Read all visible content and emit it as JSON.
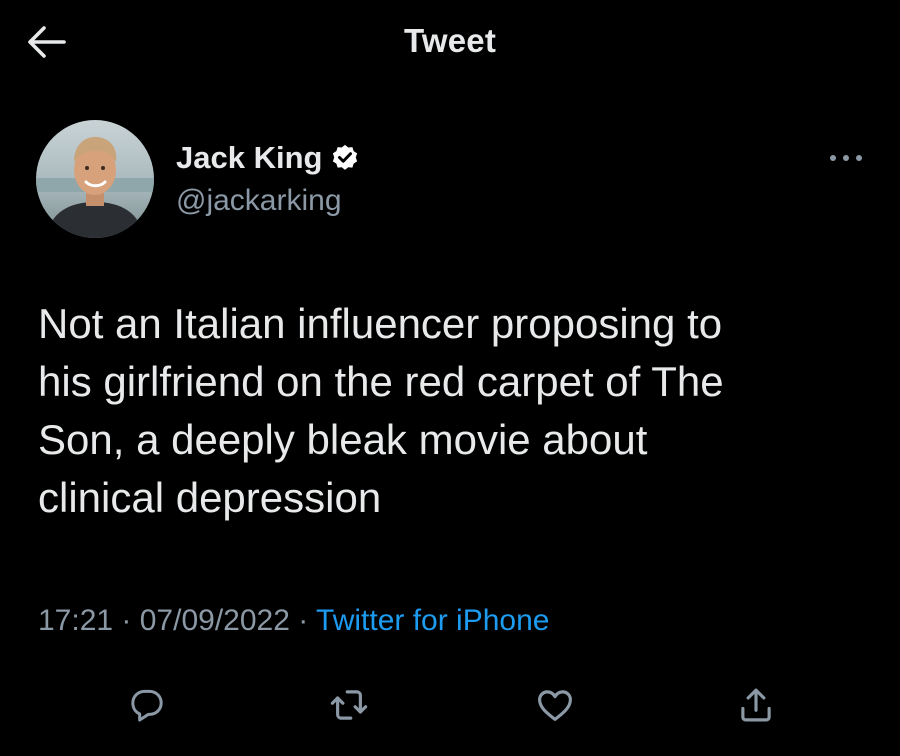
{
  "header": {
    "title": "Tweet",
    "back_icon": "arrow-left-icon"
  },
  "author": {
    "display_name": "Jack King",
    "handle": "@jackarking",
    "verified": true,
    "verified_color": "#ffffff"
  },
  "tweet": {
    "text": "Not an Italian influencer proposing to\nhis girlfriend on the red carpet of The\nSon, a deeply bleak movie about\nclinical depression",
    "time": "17:21",
    "date": "07/09/2022",
    "separator": " · ",
    "source": "Twitter for iPhone"
  },
  "actions": {
    "icons": [
      "reply-icon",
      "retweet-icon",
      "like-icon",
      "share-icon"
    ]
  },
  "colors": {
    "background": "#000000",
    "text": "#e7e9ea",
    "secondary_text": "#8b98a5",
    "link": "#1d9bf0"
  }
}
